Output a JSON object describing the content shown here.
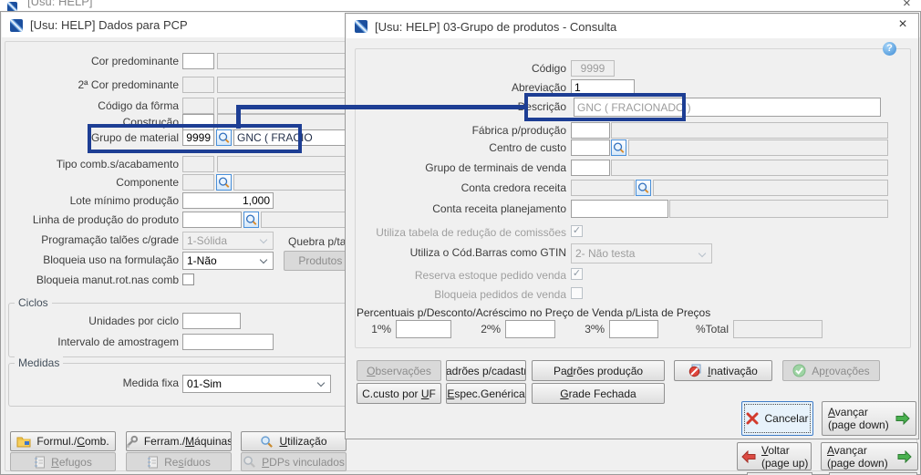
{
  "colors": {
    "annotation": "#1d3e94"
  },
  "icons": {
    "close": "×",
    "help": "?",
    "check": "✓"
  },
  "top_strip": {
    "title": "[Usu: HELP]"
  },
  "pcp": {
    "title": "[Usu: HELP] Dados para PCP",
    "f": {
      "cor": "Cor predominante",
      "cor2": "2ª Cor predominante",
      "forma": "Código da fôrma",
      "constr": "Construção",
      "grupo": "Grupo de material",
      "grupo_cod": "9999",
      "grupo_desc": "GNC ( FRACIO",
      "tipo": "Tipo comb.s/acabamento",
      "comp": "Componente",
      "lote": "Lote mínimo produção",
      "lote_val": "1,000",
      "linha": "Linha de produção do produto",
      "prog": "Programação talões c/grade",
      "prog_val": "1-Sólida",
      "quebra": "Quebra p/ta",
      "bloq_uso": "Bloqueia uso na formulação",
      "bloq_uso_val": "1-Não",
      "prod_lib": "Produtos lib",
      "bloq_manut": "Bloqueia manut.rot.nas comb",
      "ciclos": "Ciclos",
      "unid": "Unidades por ciclo",
      "interv": "Intervalo de amostragem",
      "medidas": "Medidas",
      "medida_fixa": "Medida fixa",
      "medida_fixa_val": "01-Sim"
    },
    "btn": {
      "formul": "Formul./Comb.",
      "ferram": "Ferram./Máquinas",
      "util": "Utilização",
      "refugos": "Refugos",
      "residuos": "Resíduos",
      "pdps": "PDPs vinculados"
    },
    "nav": {
      "voltar": "Voltar",
      "voltar_sub": "(page up)",
      "avancar": "Avançar",
      "avancar_sub": "(page down)"
    }
  },
  "consulta": {
    "title": "[Usu: HELP] 03-Grupo de produtos - Consulta",
    "f": {
      "codigo": "Código",
      "codigo_val": "9999",
      "abrev": "Abreviação",
      "abrev_val": "1",
      "desc": "Descrição",
      "desc_val": "GNC ( FRACIONADO )",
      "fabrica": "Fábrica p/produção",
      "ccusto": "Centro de custo",
      "gterm": "Grupo de terminais de venda",
      "ccred": "Conta credora receita",
      "crec": "Conta receita planejamento",
      "utab": "Utiliza tabela de redução de comissões",
      "gtin": "Utiliza o Cód.Barras como GTIN",
      "gtin_val": "2- Não testa",
      "reserva": "Reserva estoque pedido venda",
      "bloqped": "Bloqueia pedidos de venda",
      "perc": "Percentuais p/Desconto/Acréscimo no Preço de Venda p/Lista de Preços",
      "p1": "1º%",
      "p2": "2º%",
      "p3": "3º%",
      "ptot": "%Total"
    },
    "btn": {
      "obs": "Observações",
      "pad_cad": "Padrões p/cadastro",
      "pad_prod": "Padrões produção",
      "inativ": "Inativação",
      "aprov": "Aprovações",
      "ccusto_uf": "C.custo por UF",
      "espec": "Espec.Genérica",
      "grade": "Grade Fechada",
      "cancelar": "Cancelar",
      "avancar": "Avançar",
      "avancar_sub": "(page down)"
    }
  }
}
